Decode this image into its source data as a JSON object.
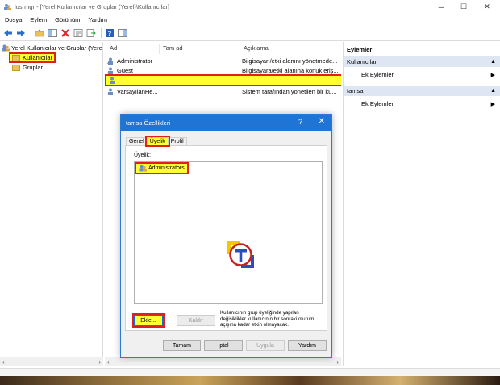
{
  "window": {
    "title": "lusrmgr - [Yerel Kullanıcılar ve Gruplar (Yerel)\\Kullanıcılar]",
    "controls": {
      "minimize": "─",
      "maximize": "☐",
      "close": "✕"
    }
  },
  "menu": [
    "Dosya",
    "Eylem",
    "Görünüm",
    "Yardım"
  ],
  "tree": {
    "root": "Yerel Kullanıcılar ve Gruplar (Yerel)",
    "items": [
      "Kullanıcılar",
      "Gruplar"
    ]
  },
  "list": {
    "columns": [
      "Ad",
      "Tam ad",
      "Açıklama"
    ],
    "rows": [
      {
        "name": "Administrator",
        "desc": "Bilgisayarı/etki alanını yönetmede..."
      },
      {
        "name": "Guest",
        "desc": "Bilgisayara/etki alanına konuk eriş..."
      },
      {
        "name": "",
        "desc": ""
      },
      {
        "name": "VarsayılanHe...",
        "desc": "Sistem tarafından yönetilen bir ku..."
      }
    ]
  },
  "actions": {
    "header": "Eylemler",
    "sections": [
      {
        "title": "Kullanıcılar",
        "item": "Ek Eylemler"
      },
      {
        "title": "tamsa",
        "item": "Ek Eylemler"
      }
    ]
  },
  "dialog": {
    "title": "tamsa Özellikleri",
    "help": "?",
    "close": "✕",
    "tabs": [
      "Genel",
      "Üyelik",
      "Profil"
    ],
    "active_tab": "Üyelik",
    "members_label": "Üyelik:",
    "members": [
      "Administrators"
    ],
    "add_button": "Ekle...",
    "remove_button": "Kaldır",
    "note": "Kullanıcının grup üyeliğinde yapılan değişiklikler kullanıcının bir sonraki oturum açışına kadar etkin olmayacak.",
    "ok": "Tamam",
    "cancel": "İptal",
    "apply": "Uygula",
    "help_button": "Yardım"
  },
  "watermark": {
    "letter": "T",
    "color": "#cc2020"
  },
  "colors": {
    "highlight": "#ffff33",
    "highlight_border": "#e02020",
    "dialog_title": "#1f74d4"
  }
}
